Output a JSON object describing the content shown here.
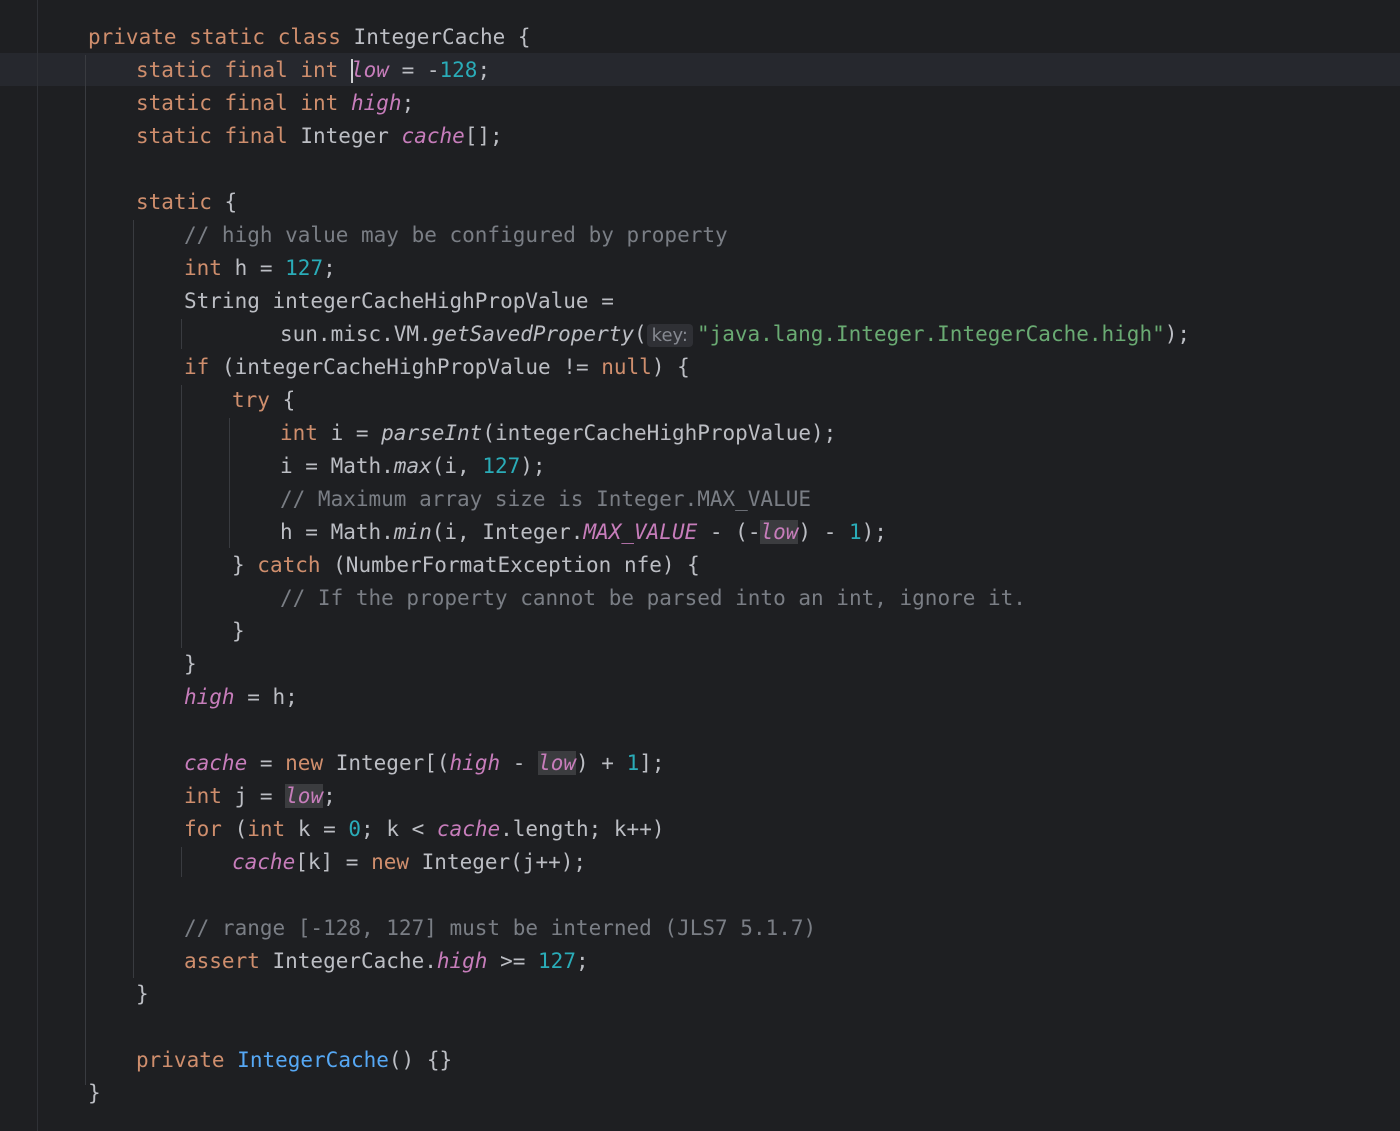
{
  "editor": {
    "lines": {
      "l1": [
        "private",
        " ",
        "static",
        " ",
        "class",
        " IntegerCache {"
      ],
      "l2": [
        "static",
        " ",
        "final",
        " ",
        "int",
        " ",
        "low",
        " = -",
        "128",
        ";"
      ],
      "l3": [
        "static",
        " ",
        "final",
        " ",
        "int",
        " ",
        "high",
        ";"
      ],
      "l4": [
        "static",
        " ",
        "final",
        " Integer ",
        "cache",
        "[];"
      ],
      "l5": [
        "static",
        " {"
      ],
      "l6": [
        "// high value may be configured by property"
      ],
      "l7": [
        "int",
        " h = ",
        "127",
        ";"
      ],
      "l8": [
        "String integerCacheHighPropValue ="
      ],
      "l9": [
        "sun.misc.VM.",
        "getSavedProperty",
        "(",
        "key:",
        "\"java.lang.Integer.IntegerCache.high\"",
        ");"
      ],
      "l10": [
        "if",
        " (integerCacheHighPropValue != ",
        "null",
        ") {"
      ],
      "l11": [
        "try",
        " {"
      ],
      "l12": [
        "int",
        " i = ",
        "parseInt",
        "(integerCacheHighPropValue);"
      ],
      "l13": [
        "i = Math.",
        "max",
        "(i, ",
        "127",
        ");"
      ],
      "l14": [
        "// Maximum array size is Integer.MAX_VALUE"
      ],
      "l15": [
        "h = Math.",
        "min",
        "(i, Integer.",
        "MAX_VALUE",
        " - (-",
        "low",
        ") - ",
        "1",
        ");"
      ],
      "l16": [
        "} ",
        "catch",
        " (NumberFormatException nfe) {"
      ],
      "l17": [
        "// If the property cannot be parsed into an int, ignore it."
      ],
      "l18": [
        "}"
      ],
      "l19": [
        "}"
      ],
      "l20": [
        "high",
        " = h;"
      ],
      "l21": [
        "cache",
        " = ",
        "new",
        " Integer[(",
        "high",
        " - ",
        "low",
        ") + ",
        "1",
        "];"
      ],
      "l22": [
        "int",
        " j = ",
        "low",
        ";"
      ],
      "l23": [
        "for",
        " (",
        "int",
        " k = ",
        "0",
        "; k < ",
        "cache",
        ".length; k++)"
      ],
      "l24": [
        "cache",
        "[k] = ",
        "new",
        " Integer(j++);"
      ],
      "l25": [
        "// range [-128, 127] must be interned (JLS7 5.1.7)"
      ],
      "l26": [
        "assert",
        " IntegerCache.",
        "high",
        " >= ",
        "127",
        ";"
      ],
      "l27": [
        "}"
      ],
      "l28": [
        "private",
        " ",
        "IntegerCache",
        "() {}"
      ],
      "l29": [
        "}"
      ]
    }
  },
  "colors": {
    "background": "#1e1f22",
    "keyword": "#cf8e6d",
    "field": "#c77dbb",
    "number": "#2aacb8",
    "comment": "#7a7e85",
    "string": "#6aab73",
    "constructor": "#56a8f5",
    "text": "#bcbec4"
  }
}
